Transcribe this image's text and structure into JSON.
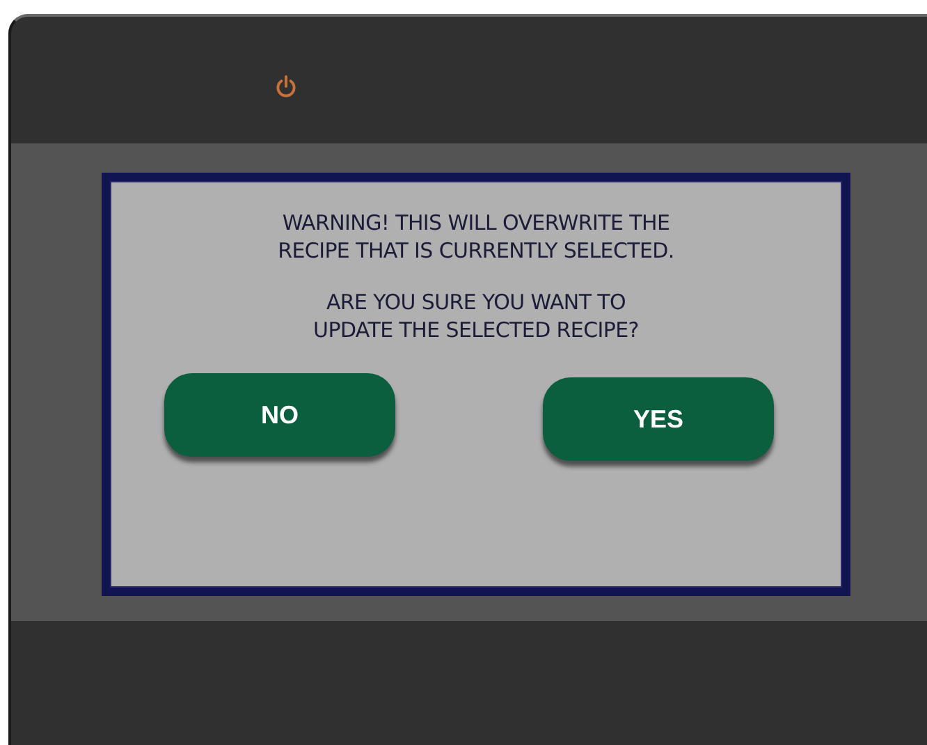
{
  "dialog": {
    "messages": [
      "WARNING! THIS WILL OVERWRITE THE\nRECIPE THAT IS CURRENTLY SELECTED.",
      "ARE YOU SURE YOU WANT TO\nUPDATE THE SELECTED RECIPE?"
    ],
    "buttons": [
      {
        "label": "NO"
      },
      {
        "label": "YES"
      }
    ]
  }
}
